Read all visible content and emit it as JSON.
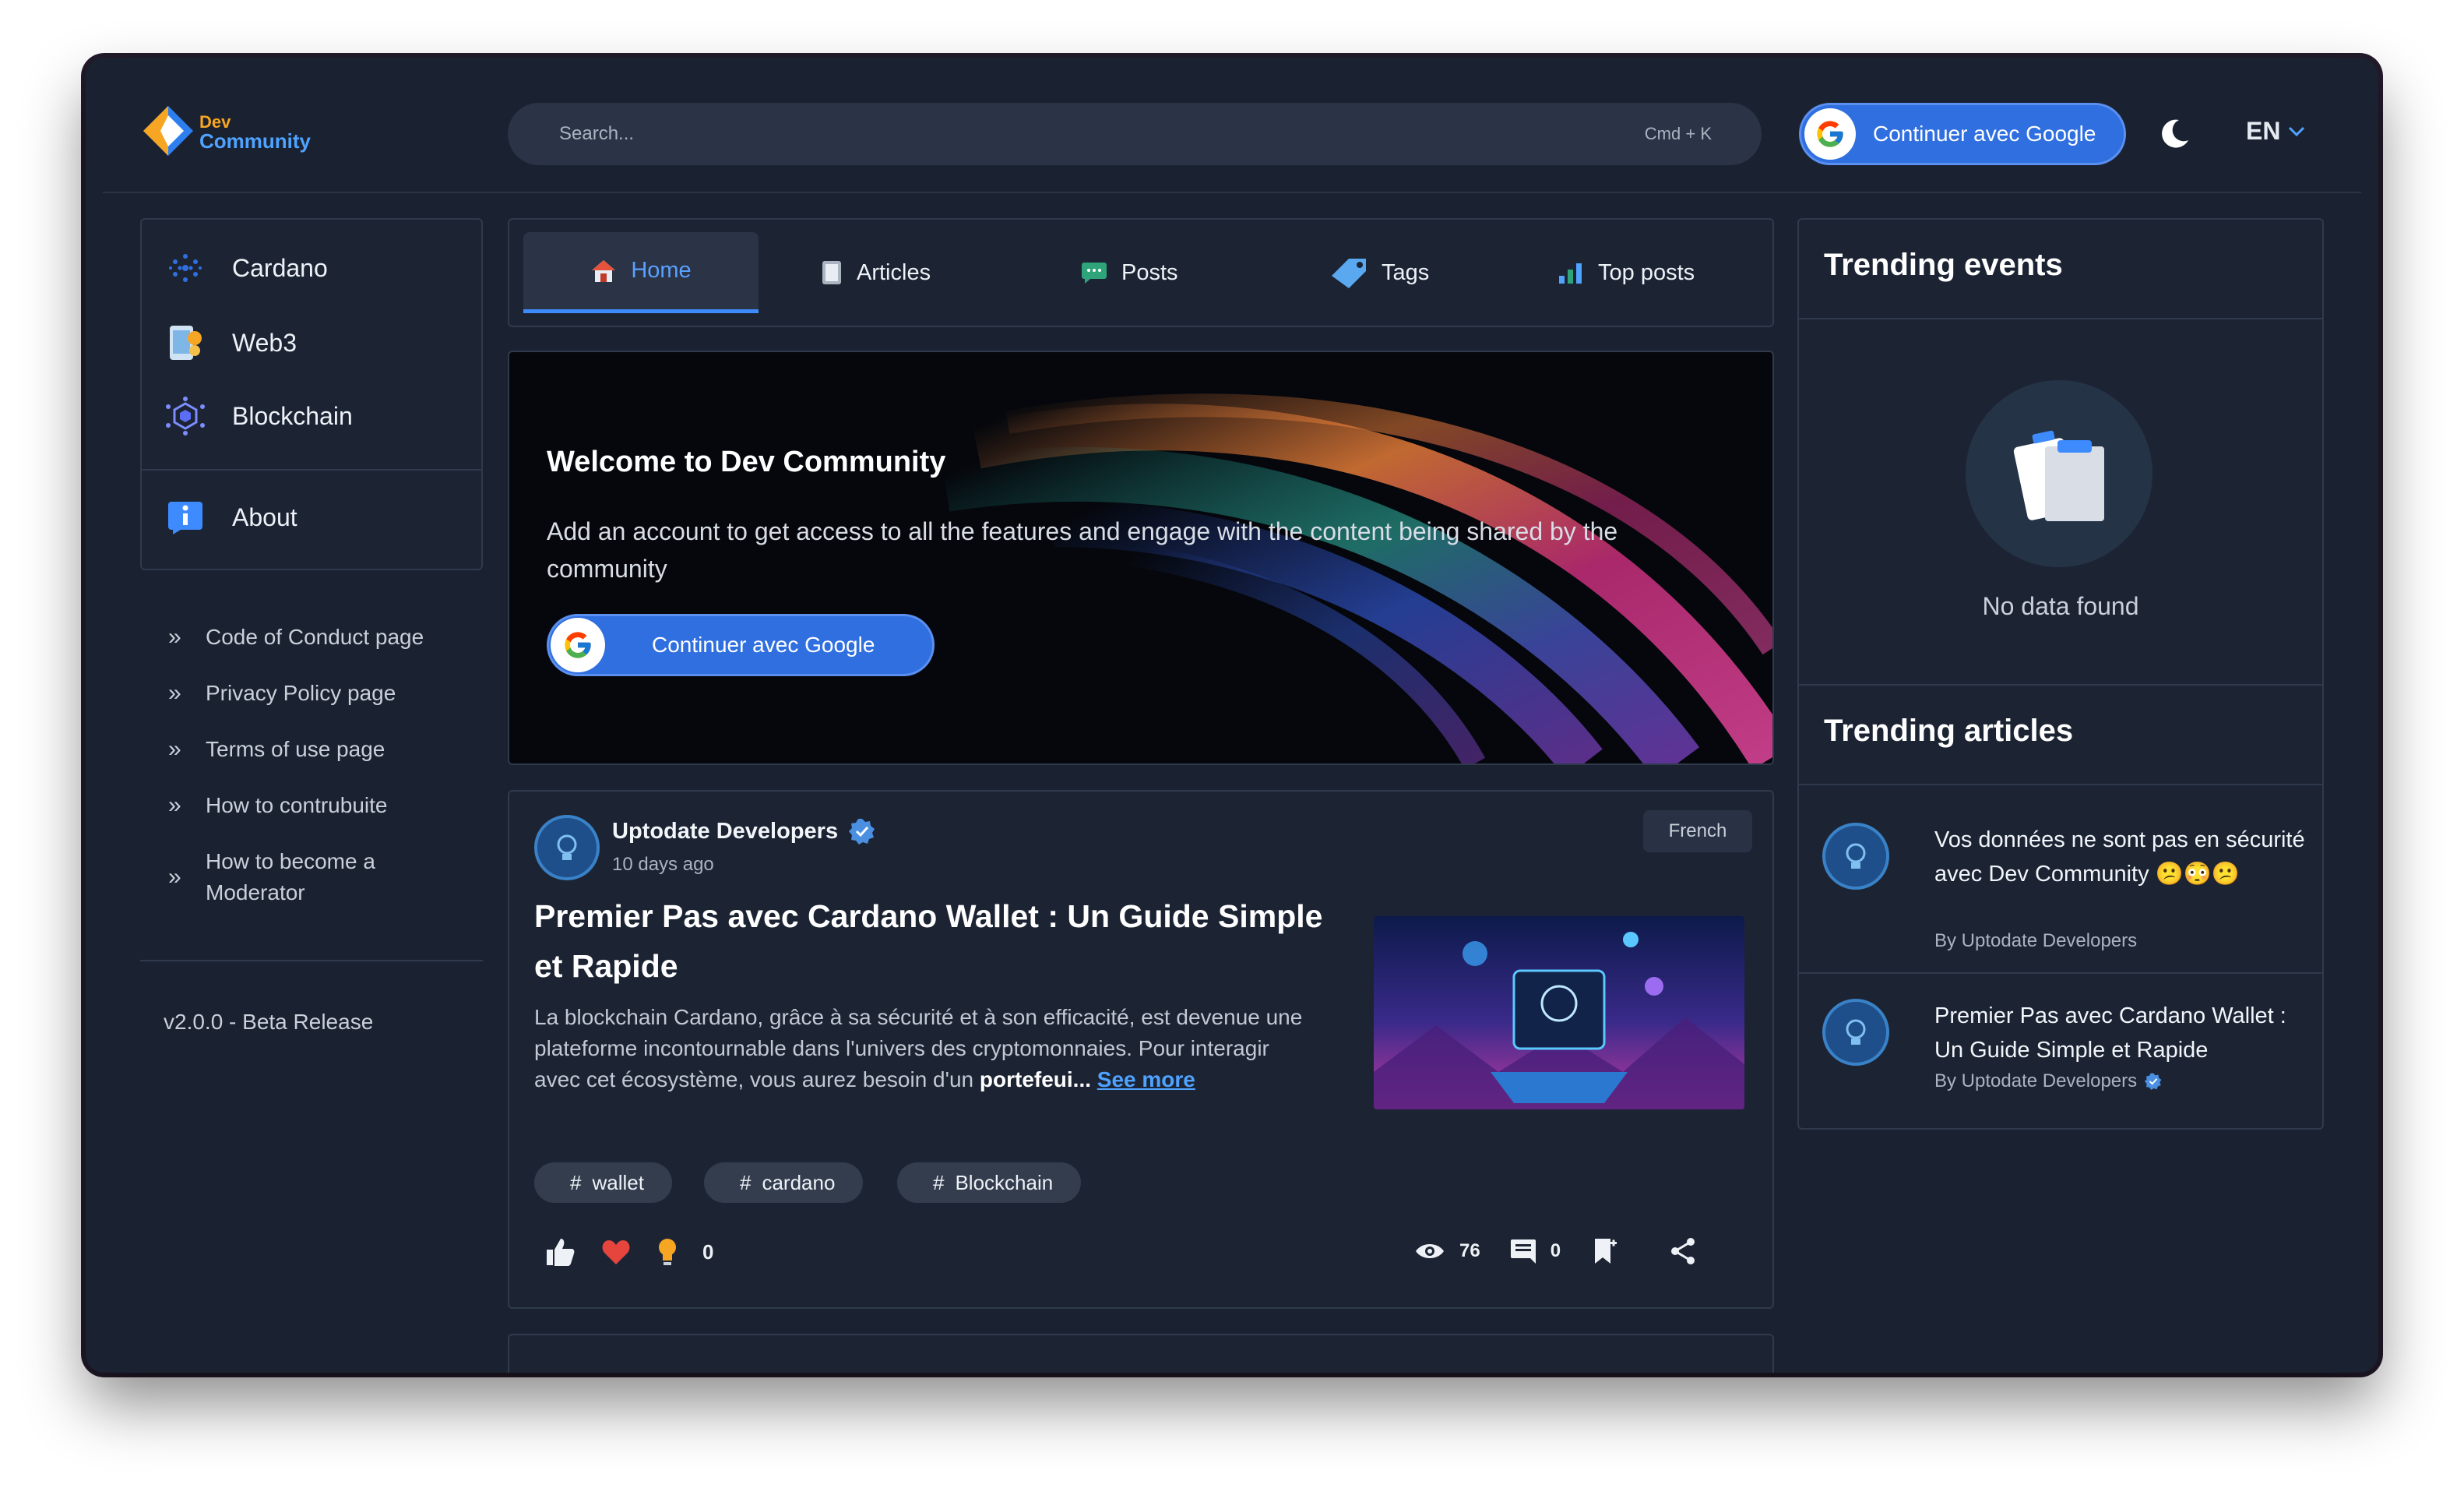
{
  "brand": {
    "line1": "Dev",
    "line2": "Community"
  },
  "header": {
    "search_placeholder": "Search...",
    "shortcut": "Cmd + K",
    "google_button": "Continuer avec Google",
    "language": "EN"
  },
  "sidebar": {
    "categories": [
      {
        "label": "Cardano",
        "icon": "cardano-icon"
      },
      {
        "label": "Web3",
        "icon": "web3-icon"
      },
      {
        "label": "Blockchain",
        "icon": "blockchain-icon"
      }
    ],
    "about": {
      "label": "About",
      "icon": "info-icon"
    },
    "links": [
      "Code of Conduct page",
      "Privacy Policy page",
      "Terms of use page",
      "How to contrubuite",
      "How to become a Moderator"
    ],
    "version": "v2.0.0 - Beta Release"
  },
  "tabs": [
    {
      "label": "Home",
      "icon": "home-icon",
      "active": true
    },
    {
      "label": "Articles",
      "icon": "articles-icon",
      "active": false
    },
    {
      "label": "Posts",
      "icon": "posts-icon",
      "active": false
    },
    {
      "label": "Tags",
      "icon": "tag-icon",
      "active": false
    },
    {
      "label": "Top posts",
      "icon": "top-posts-icon",
      "active": false
    }
  ],
  "hero": {
    "title": "Welcome to Dev Community",
    "text": "Add an account to get access to all the features and engage with the content being shared by the community",
    "button": "Continuer avec Google"
  },
  "post": {
    "author": "Uptodate Developers",
    "date": "10 days ago",
    "language": "French",
    "title": "Premier Pas avec Cardano Wallet : Un Guide Simple et Rapide",
    "excerpt": "La blockchain Cardano, grâce à sa sécurité et à son efficacité, est devenue une plateforme incontournable dans l'univers des cryptomonnaies. Pour interagir avec cet écosystème, vous aurez besoin d'un",
    "excerpt_bold": "portefeui...",
    "see_more": "See more",
    "tags": [
      "wallet",
      "cardano",
      "Blockchain"
    ],
    "reactions": "0",
    "views": "76",
    "comments": "0"
  },
  "right": {
    "events_title": "Trending events",
    "no_data": "No data found",
    "articles_title": "Trending articles",
    "articles": [
      {
        "title": "Vos données ne sont pas en sécurité avec Dev Community 😕😳😕",
        "by": "By Uptodate Developers"
      },
      {
        "title": "Premier Pas avec Cardano Wallet : Un Guide Simple et Rapide",
        "by": "By Uptodate Developers"
      }
    ]
  },
  "colors": {
    "background": "#1a2231",
    "accent": "#3d8bff",
    "google_button": "#2f6fe0"
  }
}
